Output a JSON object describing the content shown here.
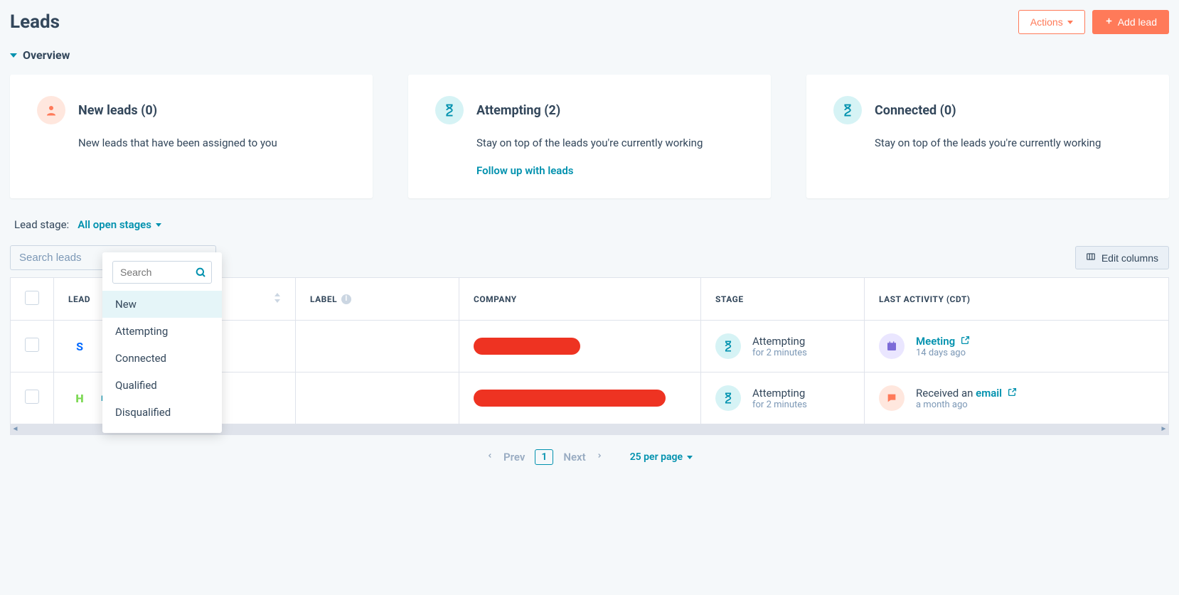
{
  "header": {
    "title": "Leads",
    "actions_label": "Actions",
    "add_lead_label": "Add lead"
  },
  "overview": {
    "section_label": "Overview",
    "cards": [
      {
        "title": "New leads (0)",
        "desc": "New leads that have been assigned to you",
        "icon": "person",
        "color": "orange",
        "link": ""
      },
      {
        "title": "Attempting (2)",
        "desc": "Stay on top of the leads you're currently working",
        "icon": "hourglass",
        "color": "teal",
        "link": "Follow up with leads"
      },
      {
        "title": "Connected (0)",
        "desc": "Stay on top of the leads you're currently working",
        "icon": "hourglass",
        "color": "teal",
        "link": ""
      }
    ]
  },
  "filter": {
    "label": "Lead stage:",
    "value": "All open stages"
  },
  "search": {
    "placeholder": "Search leads"
  },
  "edit_columns_label": "Edit columns",
  "dropdown": {
    "search_placeholder": "Search",
    "items": [
      "New",
      "Attempting",
      "Connected",
      "Qualified",
      "Disqualified"
    ]
  },
  "table": {
    "headers": {
      "lead": "LEAD",
      "label": "LABEL",
      "company": "COMPANY",
      "stage": "STAGE",
      "last_activity": "LAST ACTIVITY (CDT)"
    },
    "rows": [
      {
        "avatar_letter": "S",
        "avatar_class": "blue",
        "lead_link_suffix": "",
        "company_redact_width": 150,
        "stage_name": "Attempting",
        "stage_time": "for 2 minutes",
        "activity_icon": "calendar",
        "activity_color": "purple",
        "activity_prefix": "",
        "activity_link": "Meeting",
        "activity_time": "14 days ago"
      },
      {
        "avatar_letter": "H",
        "avatar_class": "green",
        "lead_link_suffix": "rd.tech",
        "company_redact_width": 270,
        "stage_name": "Attempting",
        "stage_time": "for 2 minutes",
        "activity_icon": "chat",
        "activity_color": "orange",
        "activity_prefix": "Received an ",
        "activity_link": "email",
        "activity_time": "a month ago"
      }
    ]
  },
  "pagination": {
    "prev": "Prev",
    "next": "Next",
    "current": "1",
    "per_page": "25 per page"
  }
}
